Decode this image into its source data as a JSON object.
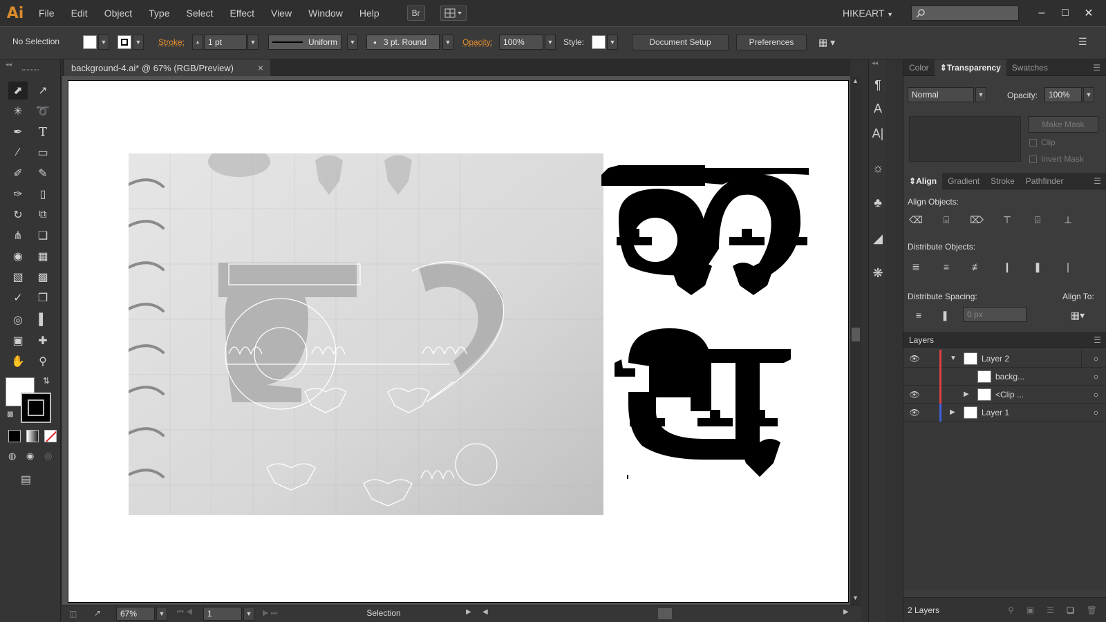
{
  "app": {
    "logo": "Ai",
    "menu": [
      "File",
      "Edit",
      "Object",
      "Type",
      "Select",
      "Effect",
      "View",
      "Window",
      "Help"
    ],
    "bridge_label": "Br",
    "workspace": "HIKEART",
    "window_controls": [
      "–",
      "□",
      "✕"
    ]
  },
  "control_bar": {
    "selection_status": "No Selection",
    "stroke_label": "Stroke:",
    "stroke_weight": "1 pt",
    "profile": "Uniform",
    "brush": "3 pt. Round",
    "opacity_label": "Opacity:",
    "opacity_value": "100%",
    "style_label": "Style:",
    "document_setup": "Document Setup",
    "preferences": "Preferences"
  },
  "document": {
    "tab_title": "background-4.ai* @ 67% (RGB/Preview)",
    "close": "×",
    "zoom": "67%",
    "page": "1",
    "status_tool": "Selection"
  },
  "transparency_panel": {
    "tabs": [
      "Color",
      "Transparency",
      "Swatches"
    ],
    "active_tab": "Transparency",
    "blend_mode": "Normal",
    "opacity_label": "Opacity:",
    "opacity_value": "100%",
    "make_mask": "Make Mask",
    "clip": "Clip",
    "invert_mask": "Invert Mask"
  },
  "align_panel": {
    "tabs": [
      "Align",
      "Gradient",
      "Stroke",
      "Pathfinder"
    ],
    "active_tab": "Align",
    "align_objects": "Align Objects:",
    "distribute_objects": "Distribute Objects:",
    "distribute_spacing": "Distribute Spacing:",
    "align_to": "Align To:",
    "spacing_value": "0 px"
  },
  "layers_panel": {
    "title": "Layers",
    "layers": [
      {
        "name": "Layer 2",
        "color": "#e04040",
        "expanded": true,
        "visible": true
      },
      {
        "name": "backg...",
        "color": "#e04040",
        "expanded": false,
        "visible": false
      },
      {
        "name": "<Clip ...",
        "color": "#e04040",
        "expanded": false,
        "visible": true
      },
      {
        "name": "Layer 1",
        "color": "#4060e0",
        "expanded": false,
        "visible": true
      }
    ],
    "count": "2 Layers"
  },
  "colors": {
    "accent_orange": "#e6902f",
    "logo_orange": "#d98a2b"
  }
}
